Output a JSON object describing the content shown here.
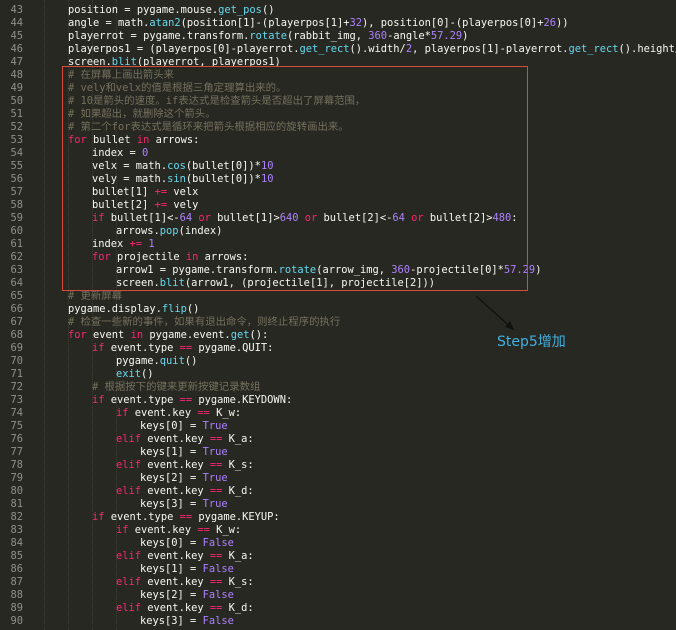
{
  "colors": {
    "background": "#272822",
    "line_number": "#8f908a",
    "text": "#f8f8f2",
    "keyword": "#f92672",
    "function": "#66d9ef",
    "number": "#ae81ff",
    "comment": "#75715e",
    "constant": "#ae81ff",
    "highlight_box": "#d64a3a",
    "annotation": "#3fb0e0"
  },
  "annotation": {
    "text": "Step5增加"
  },
  "lines": [
    {
      "no": "43",
      "indent": 1,
      "tokens": [
        [
          "t",
          "position = pygame.mouse."
        ],
        [
          "f",
          "get_pos"
        ],
        [
          "t",
          "()"
        ]
      ]
    },
    {
      "no": "44",
      "indent": 1,
      "tokens": [
        [
          "t",
          "angle = math."
        ],
        [
          "f",
          "atan2"
        ],
        [
          "t",
          "(position[1]-(playerpos[1]+"
        ],
        [
          "n",
          "32"
        ],
        [
          "t",
          "), position[0]-(playerpos[0]+"
        ],
        [
          "n",
          "26"
        ],
        [
          "t",
          "))"
        ]
      ]
    },
    {
      "no": "45",
      "indent": 1,
      "tokens": [
        [
          "t",
          "playerrot = pygame.transform."
        ],
        [
          "f",
          "rotate"
        ],
        [
          "t",
          "(rabbit_img, "
        ],
        [
          "n",
          "360"
        ],
        [
          "t",
          "-angle*"
        ],
        [
          "n",
          "57.29"
        ],
        [
          "t",
          ")"
        ]
      ]
    },
    {
      "no": "46",
      "indent": 1,
      "tokens": [
        [
          "t",
          "playerpos1 = (playerpos[0]-playerrot."
        ],
        [
          "f",
          "get_rect"
        ],
        [
          "t",
          "().width/"
        ],
        [
          "n",
          "2"
        ],
        [
          "t",
          ", playerpos[1]-playerrot."
        ],
        [
          "f",
          "get_rect"
        ],
        [
          "t",
          "().height/"
        ],
        [
          "n",
          "2"
        ],
        [
          "t",
          ")"
        ]
      ]
    },
    {
      "no": "47",
      "indent": 1,
      "tokens": [
        [
          "t",
          "screen."
        ],
        [
          "f",
          "blit"
        ],
        [
          "t",
          "(playerrot, playerpos1)"
        ]
      ]
    },
    {
      "no": "48",
      "indent": 1,
      "tokens": [
        [
          "c",
          "# 在屏幕上画出箭头来"
        ]
      ]
    },
    {
      "no": "49",
      "indent": 1,
      "tokens": [
        [
          "c",
          "# vely和velx的值是根据三角定理算出来的。"
        ]
      ]
    },
    {
      "no": "50",
      "indent": 1,
      "tokens": [
        [
          "c",
          "# 10是箭头的速度。if表达式是检查箭头是否超出了屏幕范围，"
        ]
      ]
    },
    {
      "no": "51",
      "indent": 1,
      "tokens": [
        [
          "c",
          "# 如果超出，就删除这个箭头。"
        ]
      ]
    },
    {
      "no": "52",
      "indent": 1,
      "tokens": [
        [
          "c",
          "# 第二个for表达式是循环来把箭头根据相应的旋转画出来。"
        ]
      ]
    },
    {
      "no": "53",
      "indent": 1,
      "tokens": [
        [
          "k",
          "for"
        ],
        [
          "t",
          " bullet "
        ],
        [
          "k",
          "in"
        ],
        [
          "t",
          " arrows:"
        ]
      ]
    },
    {
      "no": "54",
      "indent": 2,
      "tokens": [
        [
          "t",
          "index = "
        ],
        [
          "n",
          "0"
        ]
      ]
    },
    {
      "no": "55",
      "indent": 2,
      "tokens": [
        [
          "t",
          "velx = math."
        ],
        [
          "f",
          "cos"
        ],
        [
          "t",
          "(bullet[0])*"
        ],
        [
          "n",
          "10"
        ]
      ]
    },
    {
      "no": "56",
      "indent": 2,
      "tokens": [
        [
          "t",
          "vely = math."
        ],
        [
          "f",
          "sin"
        ],
        [
          "t",
          "(bullet[0])*"
        ],
        [
          "n",
          "10"
        ]
      ]
    },
    {
      "no": "57",
      "indent": 2,
      "tokens": [
        [
          "t",
          "bullet[1] "
        ],
        [
          "k",
          "+="
        ],
        [
          "t",
          " velx"
        ]
      ]
    },
    {
      "no": "58",
      "indent": 2,
      "tokens": [
        [
          "t",
          "bullet[2] "
        ],
        [
          "k",
          "+="
        ],
        [
          "t",
          " vely"
        ]
      ]
    },
    {
      "no": "59",
      "indent": 2,
      "tokens": [
        [
          "k",
          "if"
        ],
        [
          "t",
          " bullet[1]<-"
        ],
        [
          "n",
          "64"
        ],
        [
          "t",
          " "
        ],
        [
          "k",
          "or"
        ],
        [
          "t",
          " bullet[1]>"
        ],
        [
          "n",
          "640"
        ],
        [
          "t",
          " "
        ],
        [
          "k",
          "or"
        ],
        [
          "t",
          " bullet[2]<-"
        ],
        [
          "n",
          "64"
        ],
        [
          "t",
          " "
        ],
        [
          "k",
          "or"
        ],
        [
          "t",
          " bullet[2]>"
        ],
        [
          "n",
          "480"
        ],
        [
          "t",
          ":"
        ]
      ]
    },
    {
      "no": "60",
      "indent": 3,
      "tokens": [
        [
          "t",
          "arrows."
        ],
        [
          "f",
          "pop"
        ],
        [
          "t",
          "(index)"
        ]
      ]
    },
    {
      "no": "61",
      "indent": 2,
      "tokens": [
        [
          "t",
          "index "
        ],
        [
          "k",
          "+="
        ],
        [
          "t",
          " "
        ],
        [
          "n",
          "1"
        ]
      ]
    },
    {
      "no": "62",
      "indent": 2,
      "tokens": [
        [
          "k",
          "for"
        ],
        [
          "t",
          " projectile "
        ],
        [
          "k",
          "in"
        ],
        [
          "t",
          " arrows:"
        ]
      ]
    },
    {
      "no": "63",
      "indent": 3,
      "tokens": [
        [
          "t",
          "arrow1 = pygame.transform."
        ],
        [
          "f",
          "rotate"
        ],
        [
          "t",
          "(arrow_img, "
        ],
        [
          "n",
          "360"
        ],
        [
          "t",
          "-projectile[0]*"
        ],
        [
          "n",
          "57.29"
        ],
        [
          "t",
          ")"
        ]
      ]
    },
    {
      "no": "64",
      "indent": 3,
      "tokens": [
        [
          "t",
          "screen."
        ],
        [
          "f",
          "blit"
        ],
        [
          "t",
          "(arrow1, (projectile[1], projectile[2]))"
        ]
      ]
    },
    {
      "no": "65",
      "indent": 1,
      "tokens": [
        [
          "c",
          "# 更新屏幕"
        ]
      ]
    },
    {
      "no": "66",
      "indent": 1,
      "tokens": [
        [
          "t",
          "pygame.display."
        ],
        [
          "f",
          "flip"
        ],
        [
          "t",
          "()"
        ]
      ]
    },
    {
      "no": "67",
      "indent": 1,
      "tokens": [
        [
          "c",
          "# 检查一些新的事件，如果有退出命令，则终止程序的执行"
        ]
      ]
    },
    {
      "no": "68",
      "indent": 1,
      "tokens": [
        [
          "k",
          "for"
        ],
        [
          "t",
          " event "
        ],
        [
          "k",
          "in"
        ],
        [
          "t",
          " pygame.event."
        ],
        [
          "f",
          "get"
        ],
        [
          "t",
          "():"
        ]
      ]
    },
    {
      "no": "69",
      "indent": 2,
      "tokens": [
        [
          "k",
          "if"
        ],
        [
          "t",
          " event.type "
        ],
        [
          "k",
          "=="
        ],
        [
          "t",
          " pygame.QUIT:"
        ]
      ]
    },
    {
      "no": "70",
      "indent": 3,
      "tokens": [
        [
          "t",
          "pygame."
        ],
        [
          "f",
          "quit"
        ],
        [
          "t",
          "()"
        ]
      ]
    },
    {
      "no": "71",
      "indent": 3,
      "tokens": [
        [
          "f",
          "exit"
        ],
        [
          "t",
          "()"
        ]
      ]
    },
    {
      "no": "72",
      "indent": 2,
      "tokens": [
        [
          "c",
          "# 根据按下的键来更新按键记录数组"
        ]
      ]
    },
    {
      "no": "73",
      "indent": 2,
      "tokens": [
        [
          "k",
          "if"
        ],
        [
          "t",
          " event.type "
        ],
        [
          "k",
          "=="
        ],
        [
          "t",
          " pygame.KEYDOWN:"
        ]
      ]
    },
    {
      "no": "74",
      "indent": 3,
      "tokens": [
        [
          "k",
          "if"
        ],
        [
          "t",
          " event.key "
        ],
        [
          "k",
          "=="
        ],
        [
          "t",
          " K_w:"
        ]
      ]
    },
    {
      "no": "75",
      "indent": 4,
      "tokens": [
        [
          "t",
          "keys[0] = "
        ],
        [
          "n",
          "True"
        ]
      ]
    },
    {
      "no": "76",
      "indent": 3,
      "tokens": [
        [
          "k",
          "elif"
        ],
        [
          "t",
          " event.key "
        ],
        [
          "k",
          "=="
        ],
        [
          "t",
          " K_a:"
        ]
      ]
    },
    {
      "no": "77",
      "indent": 4,
      "tokens": [
        [
          "t",
          "keys[1] = "
        ],
        [
          "n",
          "True"
        ]
      ]
    },
    {
      "no": "78",
      "indent": 3,
      "tokens": [
        [
          "k",
          "elif"
        ],
        [
          "t",
          " event.key "
        ],
        [
          "k",
          "=="
        ],
        [
          "t",
          " K_s:"
        ]
      ]
    },
    {
      "no": "79",
      "indent": 4,
      "tokens": [
        [
          "t",
          "keys[2] = "
        ],
        [
          "n",
          "True"
        ]
      ]
    },
    {
      "no": "80",
      "indent": 3,
      "tokens": [
        [
          "k",
          "elif"
        ],
        [
          "t",
          " event.key "
        ],
        [
          "k",
          "=="
        ],
        [
          "t",
          " K_d:"
        ]
      ]
    },
    {
      "no": "81",
      "indent": 4,
      "tokens": [
        [
          "t",
          "keys[3] = "
        ],
        [
          "n",
          "True"
        ]
      ]
    },
    {
      "no": "82",
      "indent": 2,
      "tokens": [
        [
          "k",
          "if"
        ],
        [
          "t",
          " event.type "
        ],
        [
          "k",
          "=="
        ],
        [
          "t",
          " pygame.KEYUP:"
        ]
      ]
    },
    {
      "no": "83",
      "indent": 3,
      "tokens": [
        [
          "k",
          "if"
        ],
        [
          "t",
          " event.key "
        ],
        [
          "k",
          "=="
        ],
        [
          "t",
          " K_w:"
        ]
      ]
    },
    {
      "no": "84",
      "indent": 4,
      "tokens": [
        [
          "t",
          "keys[0] = "
        ],
        [
          "n",
          "False"
        ]
      ]
    },
    {
      "no": "85",
      "indent": 3,
      "tokens": [
        [
          "k",
          "elif"
        ],
        [
          "t",
          " event.key "
        ],
        [
          "k",
          "=="
        ],
        [
          "t",
          " K_a:"
        ]
      ]
    },
    {
      "no": "86",
      "indent": 4,
      "tokens": [
        [
          "t",
          "keys[1] = "
        ],
        [
          "n",
          "False"
        ]
      ]
    },
    {
      "no": "87",
      "indent": 3,
      "tokens": [
        [
          "k",
          "elif"
        ],
        [
          "t",
          " event.key "
        ],
        [
          "k",
          "=="
        ],
        [
          "t",
          " K_s:"
        ]
      ]
    },
    {
      "no": "88",
      "indent": 4,
      "tokens": [
        [
          "t",
          "keys[2] = "
        ],
        [
          "n",
          "False"
        ]
      ]
    },
    {
      "no": "89",
      "indent": 3,
      "tokens": [
        [
          "k",
          "elif"
        ],
        [
          "t",
          " event.key "
        ],
        [
          "k",
          "=="
        ],
        [
          "t",
          " K_d:"
        ]
      ]
    },
    {
      "no": "90",
      "indent": 4,
      "tokens": [
        [
          "t",
          "keys[3] = "
        ],
        [
          "n",
          "False"
        ]
      ]
    }
  ]
}
